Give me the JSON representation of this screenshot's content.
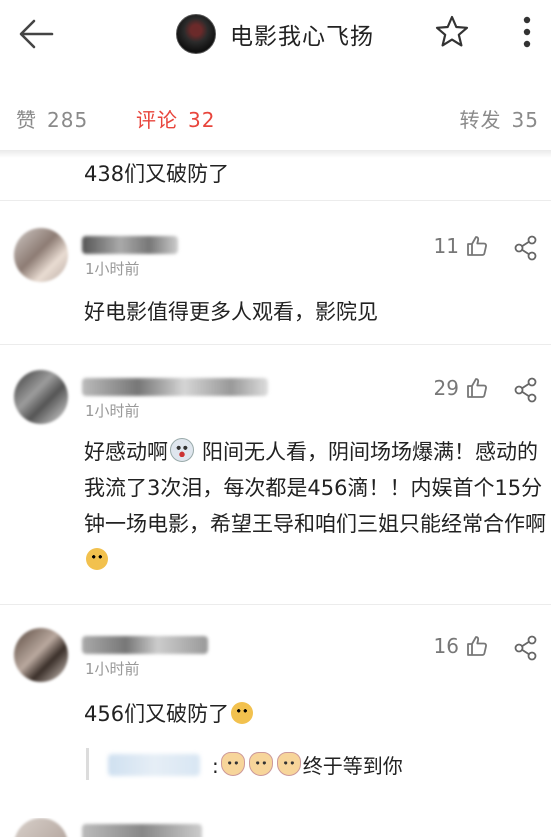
{
  "header": {
    "title": "电影我心飞扬",
    "icons": {
      "back": "back-arrow-icon",
      "favorite": "star-icon",
      "more": "more-vertical-icon"
    }
  },
  "tabs": {
    "like_label": "赞",
    "like_count": "285",
    "comment_label": "评论",
    "comment_count": "32",
    "repost_label": "转发",
    "repost_count": "35",
    "active_color": "#e8453c"
  },
  "previous_comment": {
    "text": "438们又破防了"
  },
  "comments": [
    {
      "time": "1小时前",
      "likes": "11",
      "text": "好电影值得更多人观看，影院见"
    },
    {
      "time": "1小时前",
      "likes": "29",
      "text_1": "好感动啊",
      "text_2": "阳间无人看，阴间场场爆满！感动的我流了3次泪，每次都是456滴！！内娱首个15分钟一场电影，希望王导和咱们三姐只能经常合作啊"
    },
    {
      "time": "1小时前",
      "likes": "16",
      "text": "456们又破防了",
      "reply": {
        "separator": ":",
        "text": "终于等到你"
      }
    }
  ]
}
